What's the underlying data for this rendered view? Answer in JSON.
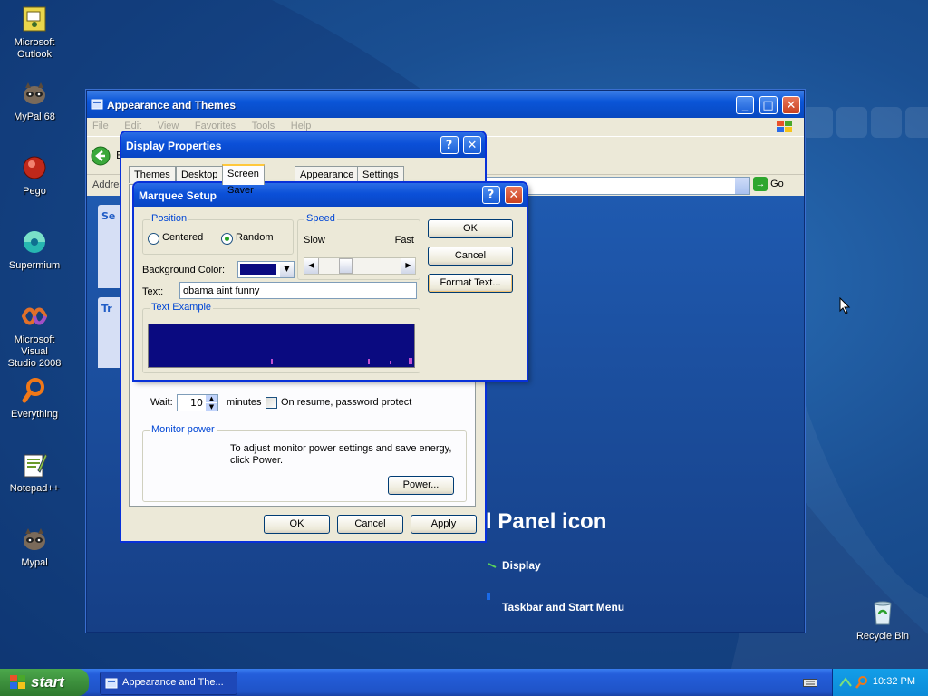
{
  "colors": {
    "desktop_blue": "#1a4f92",
    "xp_title_blue": "#0b50d8",
    "marquee_preview_bg": "#0a0a80",
    "background_color_swatch": "#0a0a80",
    "radio_dot": "#21a121"
  },
  "desktop": {
    "icons": [
      {
        "label": "Microsoft\nOutlook",
        "icon": "outlook-icon"
      },
      {
        "label": "MyPal 68",
        "icon": "raccoon-icon"
      },
      {
        "label": "Pego",
        "icon": "pego-icon"
      },
      {
        "label": "Supermium",
        "icon": "supermium-icon"
      },
      {
        "label": "Microsoft Visual\nStudio 2008",
        "icon": "visual-studio-icon"
      },
      {
        "label": "Everything",
        "icon": "everything-icon"
      },
      {
        "label": "Notepad++",
        "icon": "notepadpp-icon"
      },
      {
        "label": "Mypal",
        "icon": "raccoon-icon"
      },
      {
        "label": "Recycle Bin",
        "icon": "recycle-bin-icon"
      }
    ]
  },
  "explorer": {
    "title": "Appearance and Themes",
    "menu": [
      "File",
      "Edit",
      "View",
      "Favorites",
      "Tools",
      "Help"
    ],
    "back_label": "B",
    "address_label": "Addres",
    "go_label": "Go",
    "left_panel_letters": [
      "Se",
      "Tr"
    ],
    "heading": "l Panel icon",
    "links": [
      "Display",
      "Taskbar and Start Menu"
    ]
  },
  "display_properties": {
    "title": "Display Properties",
    "tabs": [
      "Themes",
      "Desktop",
      "Screen Saver",
      "Appearance",
      "Settings"
    ],
    "active_tab": "Screen Saver",
    "wait_label": "Wait:",
    "wait_value": "10",
    "minutes_label": "minutes",
    "resume_label": "On resume, password protect",
    "resume_checked": false,
    "monitor_power": {
      "label": "Monitor power",
      "text": "To adjust monitor power settings and save energy, click Power.",
      "button": "Power..."
    },
    "buttons": {
      "ok": "OK",
      "cancel": "Cancel",
      "apply": "Apply"
    }
  },
  "marquee_setup": {
    "title": "Marquee Setup",
    "position": {
      "label": "Position",
      "options": [
        "Centered",
        "Random"
      ],
      "selected": "Random"
    },
    "speed": {
      "label": "Speed",
      "slow": "Slow",
      "fast": "Fast",
      "level": 0.2
    },
    "background_color_label": "Background Color:",
    "text_label": "Text:",
    "text_value": "obama aint funny",
    "text_example_label": "Text Example",
    "buttons": {
      "ok": "OK",
      "cancel": "Cancel",
      "format_text": "Format Text..."
    }
  },
  "taskbar": {
    "start_label": "start",
    "task_item": "Appearance and The...",
    "clock": "10:32 PM"
  }
}
